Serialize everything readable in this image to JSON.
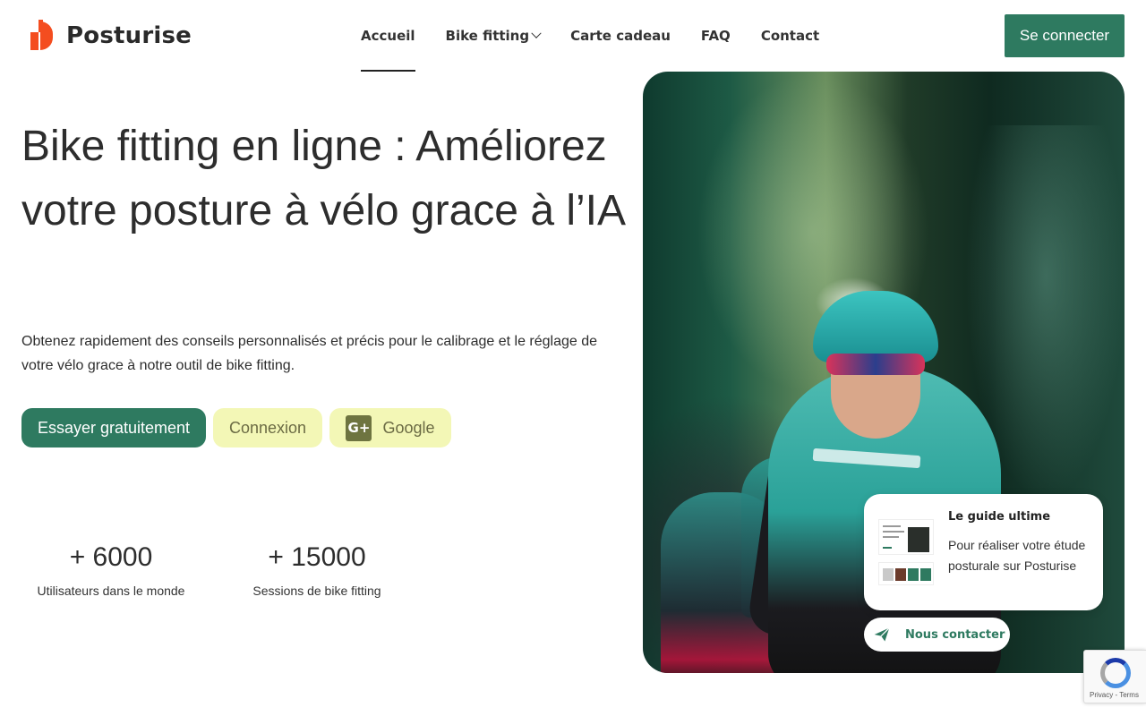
{
  "header": {
    "brand": "Posturise",
    "nav": [
      {
        "label": "Accueil",
        "active": true
      },
      {
        "label": "Bike fitting",
        "has_dropdown": true
      },
      {
        "label": "Carte cadeau"
      },
      {
        "label": "FAQ"
      },
      {
        "label": "Contact"
      }
    ],
    "login_label": "Se connecter"
  },
  "hero": {
    "title": "Bike fitting en ligne : Améliorez votre posture à vélo grace à l’IA",
    "subtitle": "Obtenez rapidement des conseils personnalisés et précis pour le calibrage et le réglage de votre vélo grace à notre outil de bike fitting.",
    "buttons": {
      "primary": "Essayer gratuitement",
      "secondary": "Connexion",
      "google": "Google",
      "google_icon_text": "G+"
    }
  },
  "stats": [
    {
      "value": "+ 6000",
      "label": "Utilisateurs dans le monde"
    },
    {
      "value": "+ 15000",
      "label": "Sessions de bike fitting"
    }
  ],
  "guide_card": {
    "title": "Le guide ultime",
    "description": "Pour réaliser votre étude posturale sur Posturise"
  },
  "contact_button": {
    "label": "Nous contacter"
  },
  "recaptcha": {
    "footer": "Privacy - Terms"
  },
  "colors": {
    "brand_green": "#2e7a60",
    "brand_orange": "#f44d1f",
    "light_button": "#f3f7b6"
  }
}
